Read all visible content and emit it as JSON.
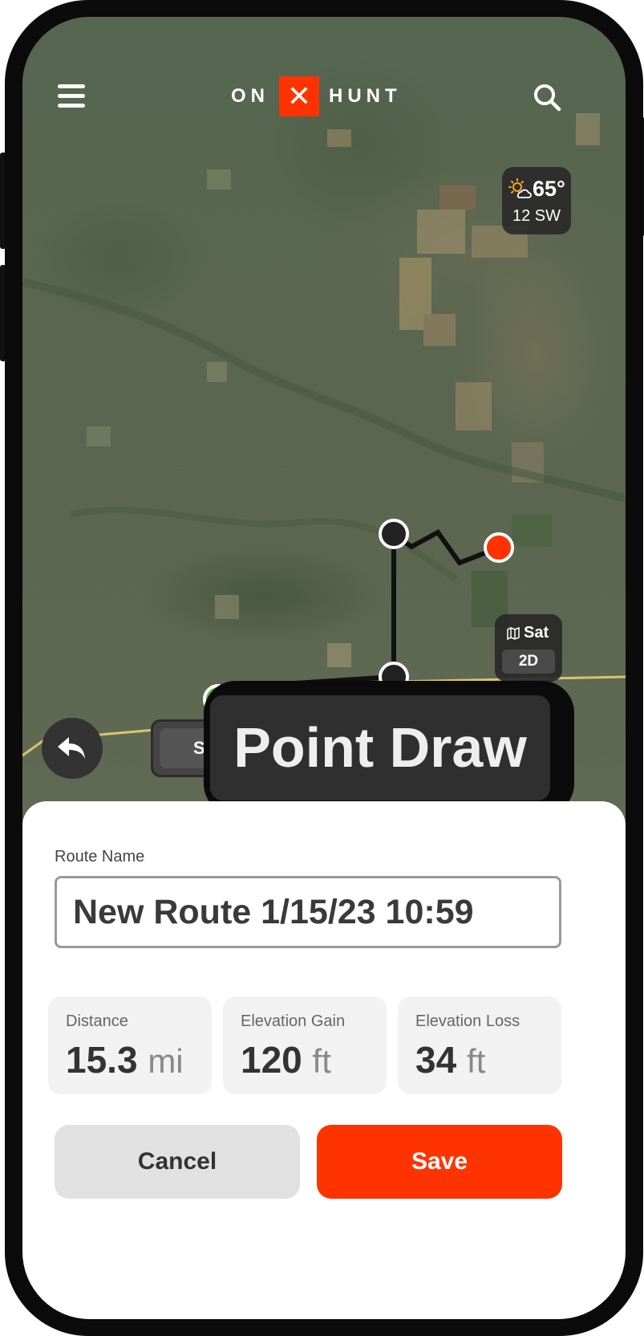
{
  "app": {
    "logo_left": "ON",
    "logo_mark": "✕",
    "logo_right": "HUNT"
  },
  "weather": {
    "temperature": "65°",
    "wind": "12 SW",
    "icon": "partly-sunny-icon"
  },
  "layers": {
    "basemap": "Sat",
    "mode": "2D",
    "icon": "map-icon"
  },
  "draw_mode": {
    "short_label": "S",
    "label": "Point Draw"
  },
  "route_sheet": {
    "name_label": "Route Name",
    "name_value": "New Route 1/15/23 10:59",
    "stats": [
      {
        "label": "Distance",
        "value": "15.3",
        "unit": "mi"
      },
      {
        "label": "Elevation Gain",
        "value": "120",
        "unit": "ft"
      },
      {
        "label": "Elevation Loss",
        "value": "34",
        "unit": "ft"
      }
    ],
    "cancel_label": "Cancel",
    "save_label": "Save"
  },
  "colors": {
    "accent": "#ff3300",
    "route_line": "#111111",
    "road": "#d9c46a",
    "start_point": "#5ab52a",
    "end_point": "#ff3300"
  }
}
